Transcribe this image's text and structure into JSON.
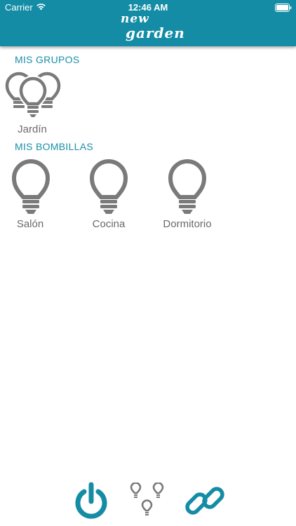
{
  "status_bar": {
    "carrier": "Carrier",
    "time": "12:46 AM"
  },
  "brand": {
    "line1": "new",
    "line2": "garden"
  },
  "colors": {
    "primary": "#148ca5",
    "section_title": "#1a8fa7",
    "icon_gray": "#7a7a7a",
    "label_gray": "#6a6a6a"
  },
  "groups": {
    "title": "MIS GRUPOS",
    "items": [
      {
        "label": "Jardín",
        "icon": "bulb-group-icon"
      }
    ]
  },
  "bulbs": {
    "title": "MIS BOMBILLAS",
    "items": [
      {
        "label": "Salón",
        "icon": "lightbulb-icon"
      },
      {
        "label": "Cocina",
        "icon": "lightbulb-icon"
      },
      {
        "label": "Dormitorio",
        "icon": "lightbulb-icon"
      }
    ]
  },
  "toolbar": {
    "items": [
      {
        "icon": "power-icon"
      },
      {
        "icon": "bulbs-icon"
      },
      {
        "icon": "link-icon"
      }
    ]
  }
}
